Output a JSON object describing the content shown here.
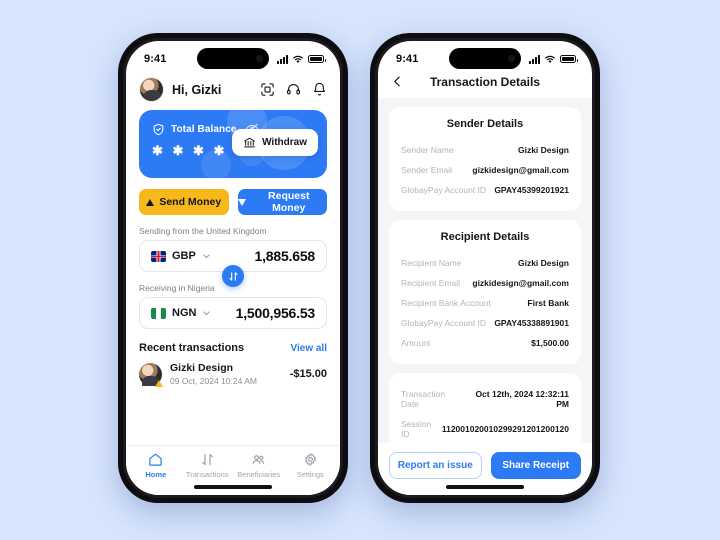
{
  "colors": {
    "page_background": "#d6e4fd",
    "accent_blue": "#2d7bf4",
    "accent_amber": "#f7b81c",
    "detail_background": "#f4f5f7"
  },
  "home": {
    "status_bar": {
      "time": "9:41",
      "signal_icon": "signal-icon",
      "wifi_icon": "wifi-icon",
      "battery_icon": "battery-icon"
    },
    "header": {
      "avatar": "avatar",
      "greeting": "Hi, Gizki",
      "icons": [
        {
          "name": "scan-qr-icon"
        },
        {
          "name": "headset-support-icon"
        },
        {
          "name": "notification-bell-icon"
        }
      ]
    },
    "balance_card": {
      "shield_icon": "shield-check-icon",
      "label": "Total Balance",
      "eye_icon": "eye-off-icon",
      "masked_value": "✱ ✱ ✱ ✱ ✱ ✱",
      "withdraw_label": "Withdraw",
      "withdraw_icon": "bank-icon"
    },
    "actions": [
      {
        "label": "Send Money",
        "icon": "arrow-up-icon",
        "style": "amber"
      },
      {
        "label": "Request Money",
        "icon": "arrow-down-icon",
        "style": "blue"
      }
    ],
    "send_section": {
      "label": "Sending from the United Kingdom",
      "flag": "flag-gb",
      "currency": "GBP",
      "amount": "1,885.658",
      "chevron_icon": "chevron-down-icon"
    },
    "swap_icon": "swap-vertical-icon",
    "receive_section": {
      "label": "Receiving in Nigeria",
      "flag": "flag-ng",
      "currency": "NGN",
      "amount": "1,500,956.53",
      "chevron_icon": "chevron-down-icon"
    },
    "recent": {
      "title": "Recent transactions",
      "view_all": "View all",
      "items": [
        {
          "name": "Gizki Design",
          "date": "09 Oct, 2024   10:24 AM",
          "amount": "-$15.00",
          "badge_icon": "warning-triangle-icon"
        }
      ]
    },
    "nav": [
      {
        "label": "Home",
        "icon": "home-icon",
        "active": true
      },
      {
        "label": "Transactions",
        "icon": "transfer-arrows-icon",
        "active": false
      },
      {
        "label": "Beneficiaries",
        "icon": "people-icon",
        "active": false
      },
      {
        "label": "Settings",
        "icon": "gear-icon",
        "active": false
      }
    ]
  },
  "details": {
    "status_bar": {
      "time": "9:41",
      "signal_icon": "signal-icon",
      "wifi_icon": "wifi-icon",
      "battery_icon": "battery-icon"
    },
    "header": {
      "back_icon": "chevron-left-icon",
      "title": "Transaction Details"
    },
    "sender": {
      "title": "Sender Details",
      "rows": [
        {
          "key": "Sender Name",
          "value": "Gizki Design"
        },
        {
          "key": "Sender Email",
          "value": "gizkidesign@gmail.com"
        },
        {
          "key": "GlobayPay Account ID",
          "value": "GPAY45399201921"
        }
      ]
    },
    "recipient": {
      "title": "Recipient Details",
      "rows": [
        {
          "key": "Recipient Name",
          "value": "Gizki Design"
        },
        {
          "key": "Recipient Email",
          "value": "gizkidesign@gmail.com"
        },
        {
          "key": "Recipient Bank Account",
          "value": "First Bank"
        },
        {
          "key": "GlobayPay Account ID",
          "value": "GPAY45338891901"
        },
        {
          "key": "Amount",
          "value": "$1,500.00"
        }
      ]
    },
    "meta": {
      "rows": [
        {
          "key": "Transaction Date",
          "value": "Oct 12th, 2024 12:32:11 PM"
        },
        {
          "key": "Session ID",
          "value": "112001020010299291201200120"
        }
      ]
    },
    "footer": {
      "report_label": "Report an issue",
      "share_label": "Share Receipt"
    }
  }
}
